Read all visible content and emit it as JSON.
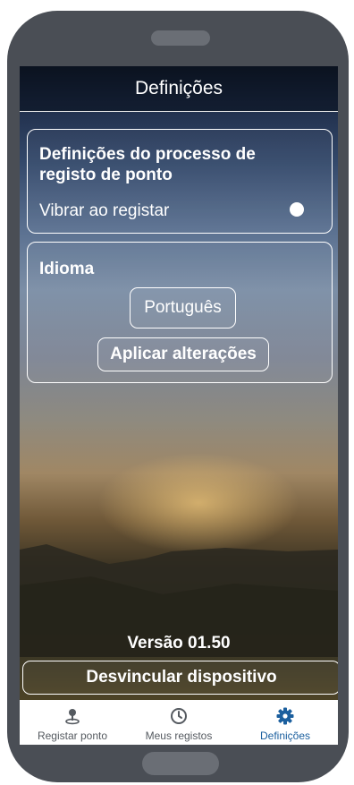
{
  "header": {
    "title": "Definições"
  },
  "punch_settings": {
    "title": "Definições do processo de registo de ponto",
    "vibrate_label": "Vibrar ao registar",
    "vibrate_enabled": false
  },
  "language": {
    "title": "Idioma",
    "selected": "Português",
    "apply_label": "Aplicar alterações"
  },
  "footer": {
    "version": "Versão 01.50",
    "unlink_label": "Desvincular dispositivo"
  },
  "nav": {
    "items": [
      {
        "label": "Registar ponto",
        "icon": "location-pin-icon",
        "active": false
      },
      {
        "label": "Meus registos",
        "icon": "clock-icon",
        "active": false
      },
      {
        "label": "Definições",
        "icon": "gear-icon",
        "active": true
      }
    ]
  },
  "colors": {
    "active": "#1b5f9e",
    "inactive": "#555a60"
  }
}
